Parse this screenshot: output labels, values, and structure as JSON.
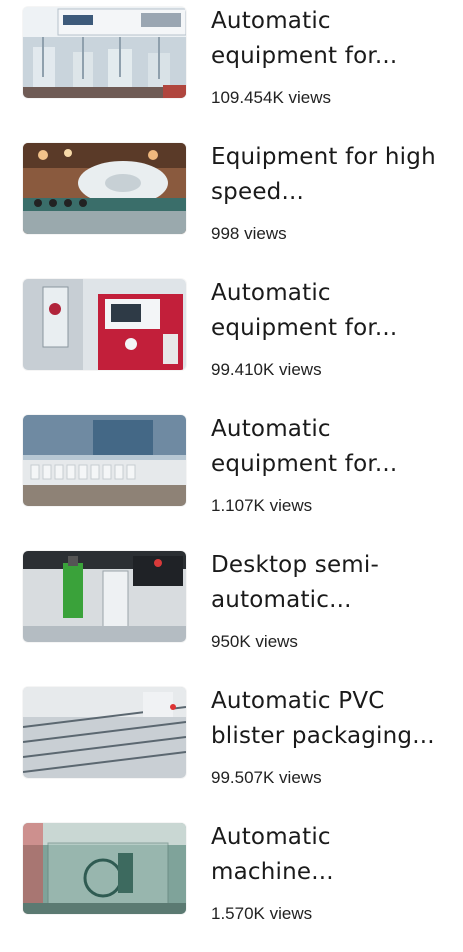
{
  "videos": [
    {
      "title": "Automatic equipment for...",
      "views": "109.454K views",
      "thumbnail_icon": "lab-dissolution-tester-thumbnail"
    },
    {
      "title": "Equipment for high speed...",
      "views": "998 views",
      "thumbnail_icon": "filling-capping-line-thumbnail"
    },
    {
      "title": "Automatic equipment for...",
      "views": "99.410K views",
      "thumbnail_icon": "bioreactor-cabinet-thumbnail"
    },
    {
      "title": "Automatic equipment for...",
      "views": "1.107K views",
      "thumbnail_icon": "bottle-conveyor-thumbnail"
    },
    {
      "title": "Desktop semi-automatic...",
      "views": "950K views",
      "thumbnail_icon": "desktop-filler-thumbnail"
    },
    {
      "title": "Automatic PVC blister packaging...",
      "views": "99.507K views",
      "thumbnail_icon": "blister-packaging-thumbnail"
    },
    {
      "title": "Automatic machine...",
      "views": "1.570K views",
      "thumbnail_icon": "machine-enclosure-thumbnail"
    }
  ]
}
